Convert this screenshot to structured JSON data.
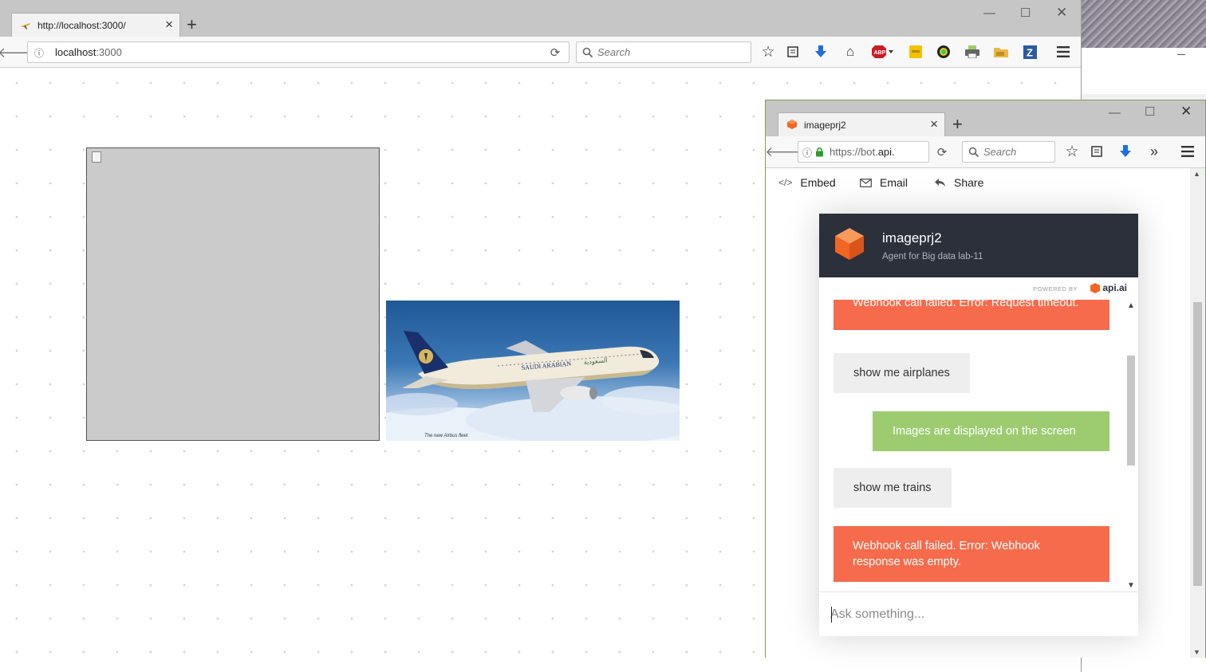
{
  "desktop": {},
  "main_browser": {
    "tab_title": "http://localhost:3000/",
    "url_host": "localhost",
    "url_port": ":3000",
    "search_placeholder": "Search"
  },
  "page": {
    "image_caption": "The new Airbus fleet"
  },
  "chat_browser": {
    "tab_title": "imageprj2",
    "url_prefix": "https://bot.",
    "url_rest": "api.",
    "search_placeholder": "Search",
    "share_bar": {
      "embed": "Embed",
      "email": "Email",
      "share": "Share"
    }
  },
  "chat": {
    "agent_name": "imageprj2",
    "agent_description": "Agent for Big data lab-11",
    "powered_by": "POWERED BY",
    "brand": "api.ai",
    "messages": [
      {
        "from": "bot-error",
        "text": "Webhook call failed. Error: Request timeout."
      },
      {
        "from": "user",
        "text": "show me airplanes"
      },
      {
        "from": "bot",
        "text": "Images are displayed on the screen"
      },
      {
        "from": "user",
        "text": "show me trains"
      },
      {
        "from": "bot-error",
        "text": "Webhook call failed. Error: Webhook response was empty."
      }
    ],
    "input_placeholder": "Ask something..."
  },
  "colors": {
    "chat_header": "#2b303b",
    "error_bubble": "#f56b4c",
    "bot_bubble": "#9dcc70",
    "user_bubble": "#eeeeee",
    "brand_orange": "#f26522"
  }
}
